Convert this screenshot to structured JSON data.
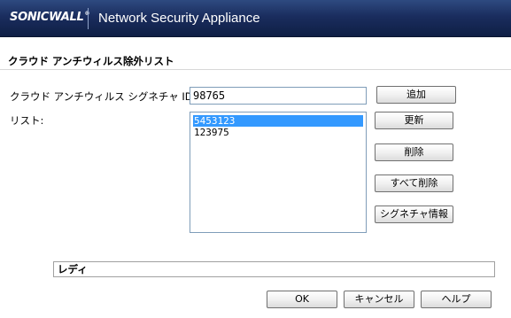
{
  "header": {
    "logo_text": "SONICWALL",
    "logo_tm": "®",
    "app_title": "Network Security Appliance",
    "background_color": "#1a2d5e"
  },
  "page": {
    "title": "クラウド アンチウィルス除外リスト"
  },
  "form": {
    "id_label": "クラウド アンチウィルス シグネチャ ID:",
    "id_value": "98765",
    "list_label": "リスト:",
    "list_items": [
      {
        "value": "5453123",
        "selected": true
      },
      {
        "value": "123975",
        "selected": false
      }
    ],
    "selection_color": "#3399ff"
  },
  "buttons": {
    "add": "追加",
    "refresh": "更新",
    "delete": "削除",
    "delete_all": "すべて削除",
    "signature_info": "シグネチャ情報"
  },
  "status": {
    "text": "レディ"
  },
  "footer": {
    "ok": "OK",
    "cancel": "キャンセル",
    "help": "ヘルプ"
  }
}
